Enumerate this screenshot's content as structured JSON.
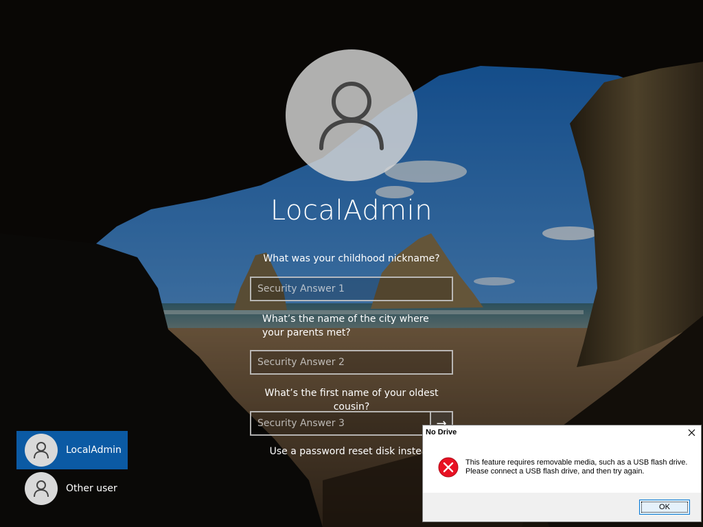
{
  "lock_screen": {
    "username": "LocalAdmin",
    "avatar_icon": "user-silhouette-icon"
  },
  "security_questions": [
    {
      "question": "What was your childhood nickname?",
      "placeholder": "Security Answer 1",
      "value": ""
    },
    {
      "question": "What’s the name of the city where your parents met?",
      "placeholder": "Security Answer 2",
      "value": ""
    },
    {
      "question": "What’s the first name of your oldest cousin?",
      "placeholder": "Security Answer 3",
      "value": ""
    }
  ],
  "submit_icon": "→",
  "reset_link": "Use a password reset disk instead",
  "users": [
    {
      "label": "LocalAdmin",
      "active": true
    },
    {
      "label": "Other user",
      "active": false
    }
  ],
  "dialog": {
    "title": "No Drive",
    "message_line1": "This feature requires removable media, such as a USB flash drive.",
    "message_line2": "Please connect a USB flash drive, and then try again.",
    "ok_label": "OK",
    "icon": "error-icon",
    "icon_color": "#e81123"
  },
  "colors": {
    "active_user_bg": "#0b5aa4",
    "dialog_button_border": "#0078d7"
  }
}
